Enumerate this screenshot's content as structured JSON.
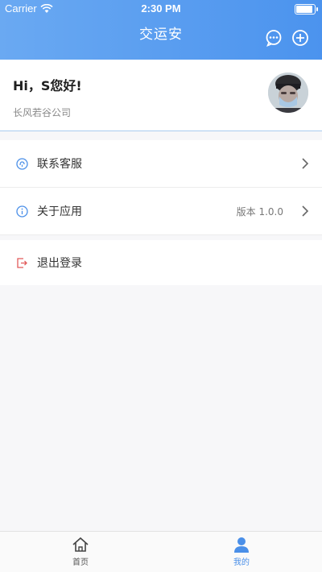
{
  "status_bar": {
    "carrier": "Carrier",
    "time": "2:30 PM"
  },
  "header": {
    "title": "交运安"
  },
  "profile": {
    "greeting": "Hi，S您好!",
    "company": "长风若谷公司"
  },
  "menu": {
    "items": [
      {
        "label": "联系客服",
        "icon": "headset-icon"
      },
      {
        "label": "关于应用",
        "icon": "info-icon",
        "value": "版本 1.0.0"
      }
    ],
    "logout": {
      "label": "退出登录",
      "icon": "logout-icon"
    }
  },
  "tabbar": {
    "tabs": [
      {
        "label": "首页",
        "icon": "home-icon",
        "active": false
      },
      {
        "label": "我的",
        "icon": "user-icon",
        "active": true
      }
    ]
  },
  "colors": {
    "accent": "#4b93ee",
    "logout": "#e25b5b"
  }
}
